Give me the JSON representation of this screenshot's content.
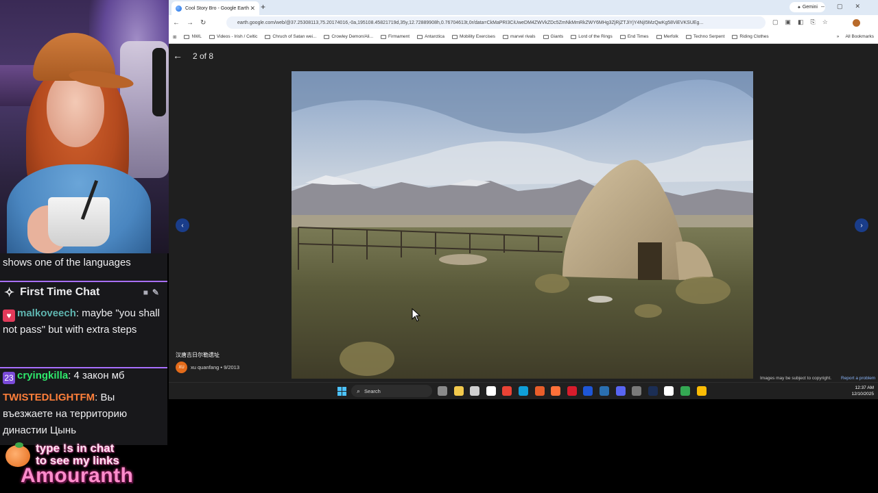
{
  "stream": {
    "chat": {
      "previous_line": "shows one of the languages",
      "first_time_chat": {
        "header": "First Time Chat",
        "username": "malkoveech",
        "message": ": maybe \"you shall not pass\" but with extra steps",
        "name_color": "#5fb5b0"
      },
      "messages": [
        {
          "username": "cryingkilla",
          "text": ": 4 закон мб",
          "name_color": "#2ee86b"
        },
        {
          "username": "TWISTEDLIGHTFM",
          "text": ": Вы въезжаете на территорию династии Цынь",
          "name_color": "#ff7f3a"
        }
      ]
    },
    "overlay": {
      "links_line1": "type !s in chat",
      "links_line2": "to see my links",
      "streamer_name": "Amouranth"
    }
  },
  "browser": {
    "tab_title": "Cool Story Bro - Google Earth",
    "gemini_label": "Gemini",
    "url": "earth.google.com/web/@37.25308113,75.20174016,-0a,195108.45821719d,35y,12.72889908h,0.76704613t,0r/data=CkMaPRI3CiUweDM4ZWVkZDc5ZmNkMmRkZWY6MHg3ZjRjZTJiYjY4NjI5MzQwKg58ViEVKSUEg...",
    "bookmarks": [
      "NWL",
      "Videos - Irish / Celtic",
      "Chruch of Satan wei...",
      "Crowley Demon/Ali...",
      "Firmament",
      "Antarctica",
      "Mobility Exercises",
      "marvel rivals",
      "Giants",
      "Lord of the Rings",
      "End Times",
      "Merfolk",
      "Techno Serpent",
      "Riding Clothes"
    ],
    "all_bookmarks": "All Bookmarks"
  },
  "viewer": {
    "counter": "2 of 8",
    "caption": "汉唐吉日尔勒遗址",
    "author_initials": "XU",
    "author": "xu quanfang • 9/2013",
    "copyright": "Images may be subject to copyright.",
    "report": "Report a problem"
  },
  "taskbar": {
    "search_label": "Search",
    "time": "12:37 AM",
    "date": "12/10/2025",
    "icon_colors": [
      "#8a8a8a",
      "#f2c94c",
      "#d0d0d0",
      "#ffffff",
      "#ea4335",
      "#0f9fd8",
      "#e85d2a",
      "#ff7139",
      "#d81c2c",
      "#1e56d6",
      "#2a6fb0",
      "#5865f2",
      "#7a7a7a",
      "#1b2e55",
      "#ffffff",
      "#34a853",
      "#fbbc05"
    ]
  },
  "colors": {
    "accent_purple": "#a970ff",
    "chat_bg": "#18181b",
    "viewer_bg": "#1f1f1f"
  }
}
